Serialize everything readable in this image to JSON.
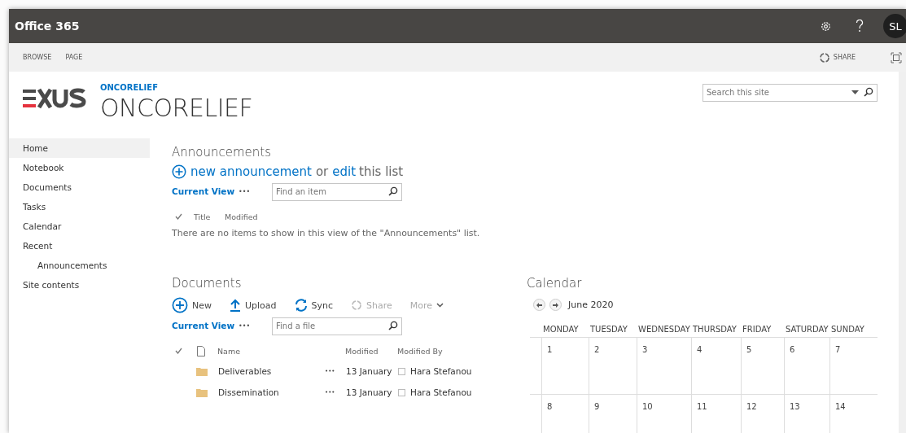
{
  "topbar": {
    "title": "Office 365",
    "avatar": "SL"
  },
  "ribbon": {
    "tabs": [
      {
        "label": "BROWSE",
        "selected": false
      },
      {
        "label": "PAGE",
        "selected": false
      }
    ],
    "share": "SHARE"
  },
  "header": {
    "breadcrumb": "ONCORELIEF",
    "site_title": "ONCORELIEF",
    "search": {
      "placeholder": "Search this site"
    }
  },
  "nav": [
    {
      "label": "Home",
      "selected": true
    },
    {
      "label": "Notebook",
      "selected": false
    },
    {
      "label": "Documents",
      "selected": false
    },
    {
      "label": "Tasks",
      "selected": false
    },
    {
      "label": "Calendar",
      "selected": false
    },
    {
      "label": "Recent",
      "selected": false,
      "children": [
        {
          "label": "Announcements",
          "selected": false
        }
      ]
    },
    {
      "label": "Site contents",
      "selected": false
    }
  ],
  "announcements": {
    "title": "Announcements",
    "new_link": "new announcement",
    "or": "or",
    "edit_link": "edit",
    "this_list": "this list",
    "current_view": "Current View",
    "ellipsis": "•••",
    "search": {
      "placeholder": "Find an item"
    },
    "columns": [
      "Title",
      "Modified"
    ],
    "empty": "There are no items to show in this view of the \"Announcements\" list."
  },
  "documents": {
    "title": "Documents",
    "actions": [
      {
        "kind": "new",
        "label": "New",
        "disabled": false
      },
      {
        "kind": "upload",
        "label": "Upload",
        "disabled": false
      },
      {
        "kind": "sync",
        "label": "Sync",
        "disabled": false
      },
      {
        "kind": "share",
        "label": "Share",
        "disabled": true
      },
      {
        "kind": "more",
        "label": "More",
        "disabled": true
      }
    ],
    "current_view": "Current View",
    "ellipsis": "•••",
    "search": {
      "placeholder": "Find a file"
    },
    "columns": [
      "Name",
      "Modified",
      "Modified By"
    ],
    "rows": [
      {
        "name": "Deliverables",
        "menu": "•••",
        "modified": "13 January",
        "modified_by": "Hara Stefanou"
      },
      {
        "name": "Dissemination",
        "menu": "•••",
        "modified": "13 January",
        "modified_by": "Hara Stefanou"
      }
    ]
  },
  "calendar": {
    "title": "Calendar",
    "month": "June 2020",
    "weekdays": [
      "MONDAY",
      "TUESDAY",
      "WEDNESDAY",
      "THURSDAY",
      "FRIDAY",
      "SATURDAY",
      "SUNDAY"
    ],
    "weeks": [
      [
        "1",
        "2",
        "3",
        "4",
        "5",
        "6",
        "7"
      ],
      [
        "8",
        "9",
        "10",
        "11",
        "12",
        "13",
        "14"
      ]
    ]
  }
}
